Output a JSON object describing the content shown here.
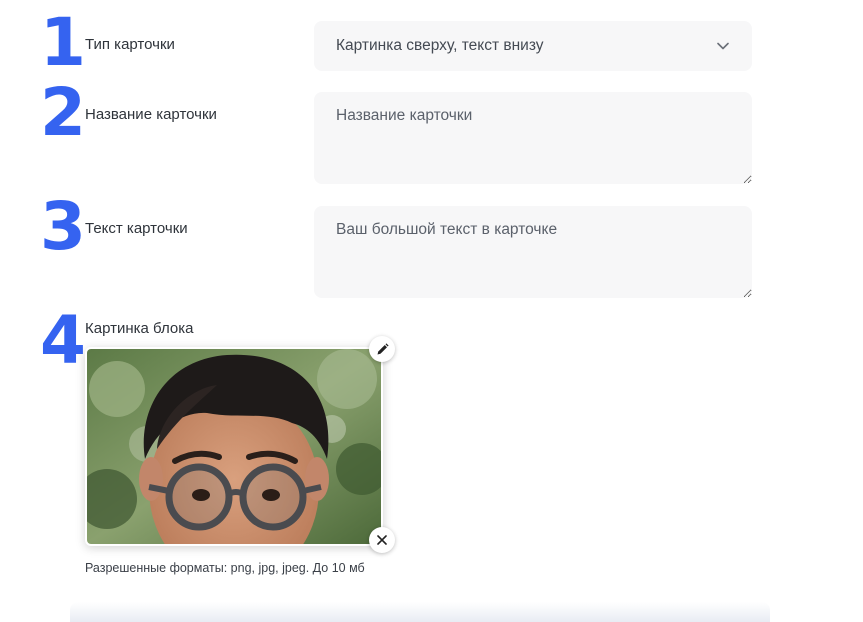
{
  "steps": [
    "1",
    "2",
    "3",
    "4"
  ],
  "card_type": {
    "label": "Тип карточки",
    "selected": "Картинка сверху, текст внизу"
  },
  "card_title": {
    "label": "Название карточки",
    "placeholder": "Название карточки"
  },
  "card_text": {
    "label": "Текст карточки",
    "placeholder": "Ваш большой текст в карточке"
  },
  "block_image": {
    "label": "Картинка блока",
    "hint": "Разрешенные форматы: png, jpg, jpeg. До 10 мб"
  },
  "icons": {
    "select_chevron": "chevron-down-icon",
    "edit": "pencil-icon",
    "remove": "close-icon"
  },
  "colors": {
    "step_number": "#3563f0",
    "field_background": "#f7f7f8"
  }
}
